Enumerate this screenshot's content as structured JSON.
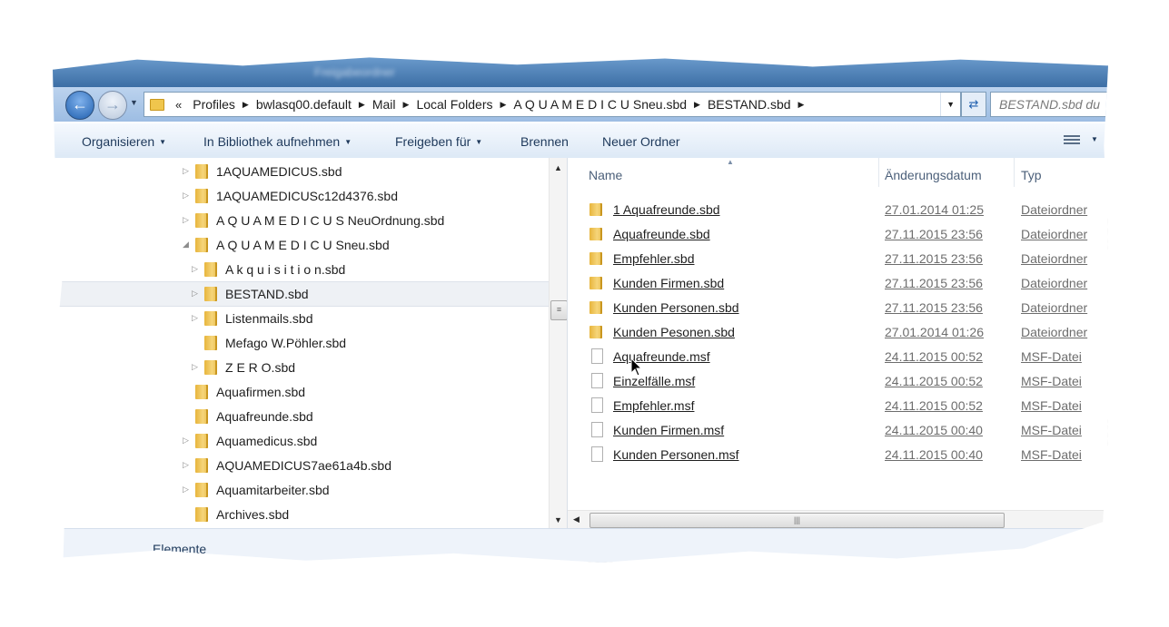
{
  "window": {
    "title": "Freigabeordner"
  },
  "address": {
    "overflow": "«",
    "segments": [
      "Profiles",
      "bwlasq00.default",
      "Mail",
      "Local Folders",
      "A Q U A M E D I C U Sneu.sbd",
      "BESTAND.sbd"
    ]
  },
  "search": {
    "placeholder": "BESTAND.sbd du"
  },
  "toolbar": {
    "organize": "Organisieren",
    "library": "In Bibliothek aufnehmen",
    "share": "Freigeben für",
    "burn": "Brennen",
    "new_folder": "Neuer Ordner"
  },
  "tree": {
    "items": [
      {
        "label": "1AQUAMEDICUS.sbd",
        "expander": "▷"
      },
      {
        "label": "1AQUAMEDICUSc12d4376.sbd",
        "expander": "▷"
      },
      {
        "label": "A Q U A M E D I C U S NeuOrdnung.sbd",
        "expander": "▷"
      },
      {
        "label": "A Q U A M E D I C U Sneu.sbd",
        "expander": "◢"
      },
      {
        "label": "A k q u i s i t i o n.sbd",
        "expander": "▷"
      },
      {
        "label": "BESTAND.sbd",
        "expander": "▷"
      },
      {
        "label": "Listenmails.sbd",
        "expander": "▷"
      },
      {
        "label": "Mefago W.Pöhler.sbd",
        "expander": ""
      },
      {
        "label": "Z E R O.sbd",
        "expander": "▷"
      },
      {
        "label": "Aquafirmen.sbd",
        "expander": ""
      },
      {
        "label": "Aquafreunde.sbd",
        "expander": ""
      },
      {
        "label": "Aquamedicus.sbd",
        "expander": "▷"
      },
      {
        "label": "AQUAMEDICUS7ae61a4b.sbd",
        "expander": "▷"
      },
      {
        "label": "Aquamitarbeiter.sbd",
        "expander": "▷"
      },
      {
        "label": "Archives.sbd",
        "expander": ""
      }
    ],
    "selected": "BESTAND.sbd"
  },
  "columns": {
    "name": "Name",
    "date": "Änderungsdatum",
    "type": "Typ"
  },
  "files": [
    {
      "name": "1 Aquafreunde.sbd",
      "date": "27.01.2014 01:25",
      "type": "Dateiordner",
      "icon": "folder-icon"
    },
    {
      "name": "Aquafreunde.sbd",
      "date": "27.11.2015 23:56",
      "type": "Dateiordner",
      "icon": "folder-icon"
    },
    {
      "name": "Empfehler.sbd",
      "date": "27.11.2015 23:56",
      "type": "Dateiordner",
      "icon": "folder-icon"
    },
    {
      "name": "Kunden Firmen.sbd",
      "date": "27.11.2015 23:56",
      "type": "Dateiordner",
      "icon": "folder-icon"
    },
    {
      "name": "Kunden Personen.sbd",
      "date": "27.11.2015 23:56",
      "type": "Dateiordner",
      "icon": "folder-icon"
    },
    {
      "name": "Kunden Pesonen.sbd",
      "date": "27.01.2014 01:26",
      "type": "Dateiordner",
      "icon": "folder-icon"
    },
    {
      "name": "Aquafreunde.msf",
      "date": "24.11.2015 00:52",
      "type": "MSF-Datei",
      "icon": "file-icon"
    },
    {
      "name": "Einzelfälle.msf",
      "date": "24.11.2015 00:52",
      "type": "MSF-Datei",
      "icon": "file-icon"
    },
    {
      "name": "Empfehler.msf",
      "date": "24.11.2015 00:52",
      "type": "MSF-Datei",
      "icon": "file-icon"
    },
    {
      "name": "Kunden Firmen.msf",
      "date": "24.11.2015 00:40",
      "type": "MSF-Datei",
      "icon": "file-icon"
    },
    {
      "name": "Kunden Personen.msf",
      "date": "24.11.2015 00:40",
      "type": "MSF-Datei",
      "icon": "file-icon"
    }
  ],
  "status": {
    "text": "Elemente"
  }
}
